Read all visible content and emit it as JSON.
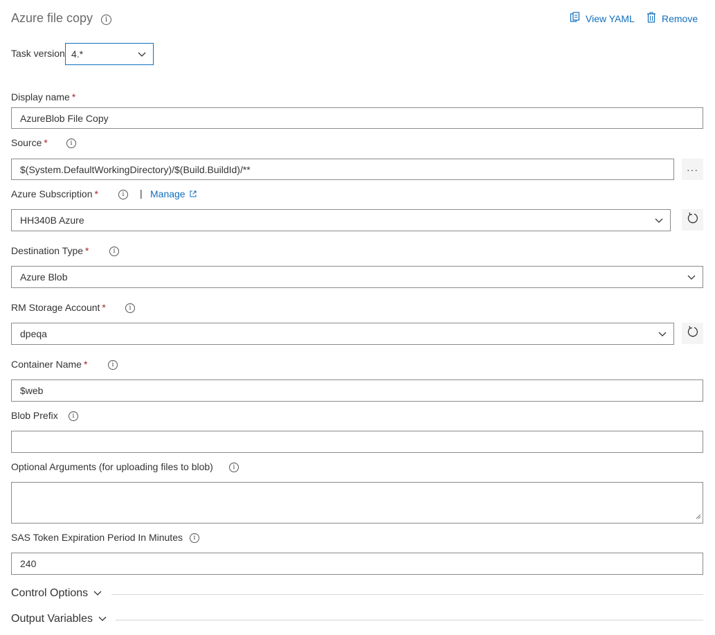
{
  "header": {
    "title": "Azure file copy",
    "view_yaml": "View YAML",
    "remove": "Remove"
  },
  "task_version": {
    "label": "Task version",
    "value": "4.*"
  },
  "fields": {
    "display_name": {
      "label": "Display name",
      "required": "*",
      "value": "AzureBlob File Copy"
    },
    "source": {
      "label": "Source",
      "required": "*",
      "value": "$(System.DefaultWorkingDirectory)/$(Build.BuildId)/**",
      "browse": "···"
    },
    "azure_subscription": {
      "label": "Azure Subscription",
      "required": "*",
      "separator": "|",
      "manage": "Manage",
      "value": "HH340B Azure"
    },
    "destination_type": {
      "label": "Destination Type",
      "required": "*",
      "value": "Azure Blob"
    },
    "rm_storage_account": {
      "label": "RM Storage Account",
      "required": "*",
      "value": "dpeqa"
    },
    "container_name": {
      "label": "Container Name",
      "required": "*",
      "value": "$web"
    },
    "blob_prefix": {
      "label": "Blob Prefix",
      "value": ""
    },
    "optional_arguments": {
      "label": "Optional Arguments (for uploading files to blob)",
      "value": ""
    },
    "sas_token": {
      "label": "SAS Token Expiration Period In Minutes",
      "value": "240"
    }
  },
  "sections": {
    "control_options": "Control Options",
    "output_variables": "Output Variables"
  },
  "colors": {
    "link": "#106ebe",
    "required": "#a4262c",
    "border": "#8a8a8a",
    "focus": "#106ebe"
  }
}
